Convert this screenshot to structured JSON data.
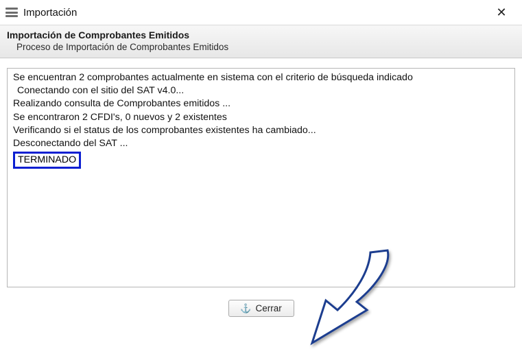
{
  "window": {
    "title": "Importación"
  },
  "header": {
    "title": "Importación de Comprobantes Emitidos",
    "subtitle": "Proceso de Importación de Comprobantes Emitidos"
  },
  "log": {
    "lines": [
      "Se encuentran 2 comprobantes actualmente en sistema con el criterio de búsqueda indicado",
      "Conectando con el sitio del SAT v4.0...",
      "Realizando consulta de Comprobantes emitidos ...",
      "Se encontraron 2 CFDI's, 0 nuevos y 2 existentes",
      "Verificando si el status de los comprobantes existentes ha cambiado...",
      "Desconectando del SAT ..."
    ],
    "final": "TERMINADO"
  },
  "buttons": {
    "close_label": "Cerrar"
  },
  "icons": {
    "anchor": "⚓",
    "close_x": "✕"
  }
}
